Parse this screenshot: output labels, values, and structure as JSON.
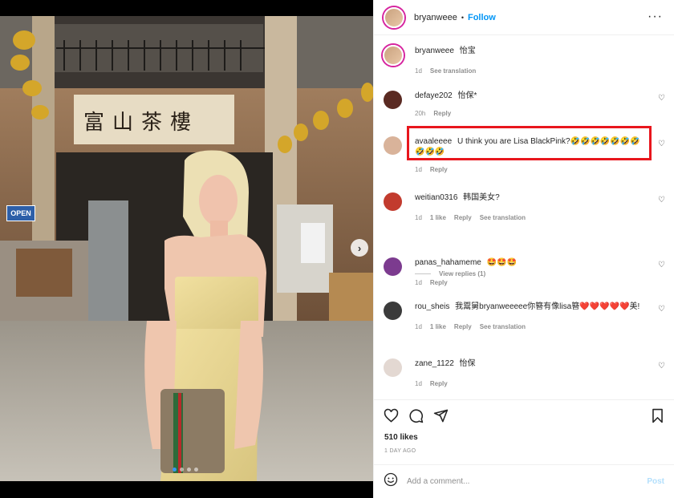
{
  "post": {
    "username": "bryanweee",
    "separator": "•",
    "follow_label": "Follow",
    "more_label": "···"
  },
  "caption": {
    "username": "bryanweee",
    "text": "怡宝",
    "time": "1d",
    "see_translation": "See translation"
  },
  "comments": [
    {
      "username": "defaye202",
      "text": "怡保*",
      "time": "20h",
      "likes": "",
      "reply": "Reply",
      "see_translation": ""
    },
    {
      "username": "avaaleeee",
      "text": "U think you are Lisa BlackPink?🤣🤣🤣🤣🤣🤣🤣🤣🤣🤣",
      "time": "1d",
      "likes": "",
      "reply": "Reply",
      "see_translation": ""
    },
    {
      "username": "weitian0316",
      "text": "韩国美女?",
      "time": "1d",
      "likes": "1 like",
      "reply": "Reply",
      "see_translation": "See translation"
    },
    {
      "username": "panas_hahameme",
      "text": "🤩🤩🤩",
      "time": "1d",
      "likes": "",
      "reply": "Reply",
      "see_translation": ""
    },
    {
      "username": "rou_sheis",
      "text": "我鬻舅bryanweeeee你簪有像lisa簪❤️❤️❤️❤️❤️美!",
      "time": "1d",
      "likes": "1 like",
      "reply": "Reply",
      "see_translation": "See translation"
    },
    {
      "username": "zane_1122",
      "text": "怡保",
      "time": "1d",
      "likes": "",
      "reply": "Reply",
      "see_translation": ""
    }
  ],
  "view_replies": "View replies (1)",
  "icons": {
    "heart": "heart-icon",
    "comment": "comment-icon",
    "share": "share-icon",
    "bookmark": "bookmark-icon",
    "emoji": "emoji-icon",
    "next": "chevron-right-icon"
  },
  "likes_label": "510 likes",
  "timestamp": "1 DAY AGO",
  "add_comment": {
    "placeholder": "Add a comment...",
    "post_label": "Post"
  },
  "storefront_sign": "富山茶樓",
  "open_sign": "OPEN",
  "colors": {
    "accent": "#0095f6",
    "highlight": "#e8161d",
    "active_dot": "#3897f0"
  }
}
